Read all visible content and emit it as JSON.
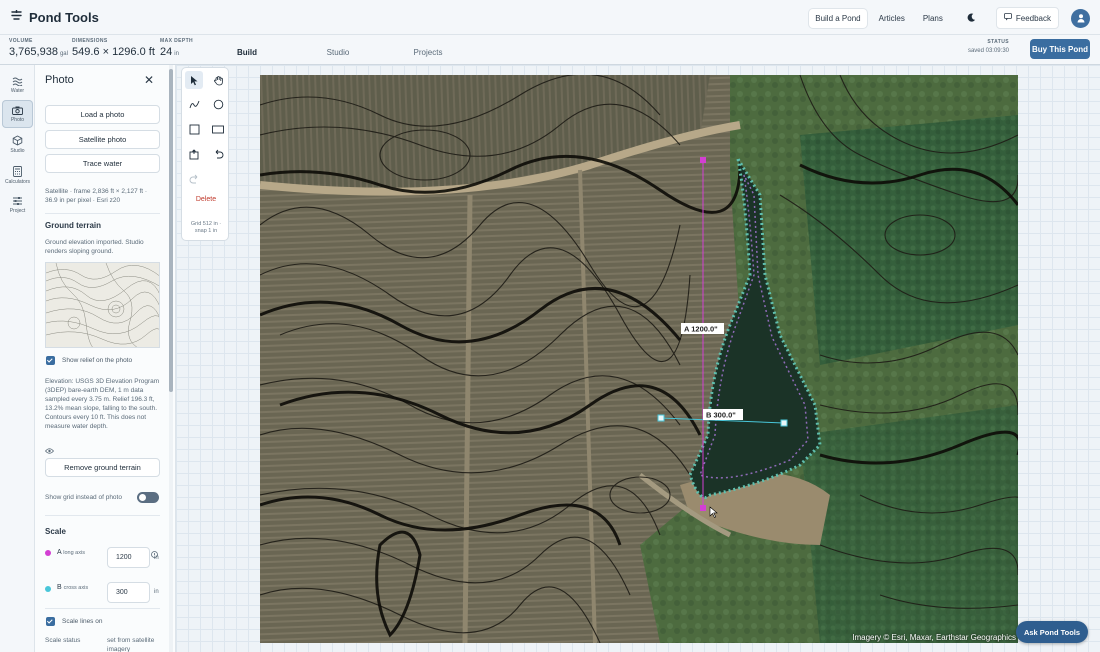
{
  "app": {
    "name": "Pond Tools"
  },
  "nav": {
    "links": [
      "Build a Pond",
      "Articles",
      "Plans"
    ],
    "feedback": "Feedback"
  },
  "stats": {
    "volume": {
      "label": "VOLUME",
      "value": "3,765,938",
      "unit": "gal"
    },
    "dimensions": {
      "label": "DIMENSIONS",
      "value": "549.6 × 1296.0 ft"
    },
    "max_depth": {
      "label": "MAX DEPTH",
      "value": "24",
      "unit": "in"
    }
  },
  "tabs": [
    "Build",
    "Studio",
    "Projects"
  ],
  "status": {
    "label": "STATUS",
    "value": "saved 03:09:30"
  },
  "buy_button": "Buy This Pond",
  "rail": [
    "Water",
    "Photo",
    "Studio",
    "Calculators",
    "Project"
  ],
  "panel": {
    "title": "Photo",
    "buttons": {
      "load": "Load a photo",
      "satellite": "Satellite photo",
      "trace": "Trace water"
    },
    "satellite_info": "Satellite · frame 2,836 ft × 2,127 ft · 36.9 in per pixel · Esri z20",
    "ground_terrain_title": "Ground terrain",
    "ground_terrain_note": "Ground elevation imported. Studio renders sloping ground.",
    "show_relief": "Show relief on the photo",
    "elevation_note": "Elevation: USGS 3D Elevation Program (3DEP) bare-earth DEM, 1 m data sampled every 3.75 m. Relief 196.3 ft, 13.2% mean slope, falling to the south. Contours every 10 ft. This does not measure water depth.",
    "remove_terrain": "Remove ground terrain",
    "show_grid": "Show grid instead of photo",
    "scale_title": "Scale",
    "axis_a": {
      "letter": "A",
      "name": "long axis",
      "value": "1200",
      "unit": "in",
      "color": "#d33fd3"
    },
    "axis_b": {
      "letter": "B",
      "name": "cross axis",
      "value": "300",
      "unit": "in",
      "color": "#48c6d9"
    },
    "scale_lines": "Scale lines on",
    "scale_status_label": "Scale status",
    "scale_status_value": "set from satellite imagery"
  },
  "tools": {
    "delete": "Delete",
    "grid_info": "Grid 512 in · snap 1 in"
  },
  "map": {
    "label_a": "A  1200.0\"",
    "label_b": "B  300.0\"",
    "credit": "Imagery © Esri, Maxar, Earthstar Geographics"
  },
  "ask_button": "Ask Pond Tools"
}
